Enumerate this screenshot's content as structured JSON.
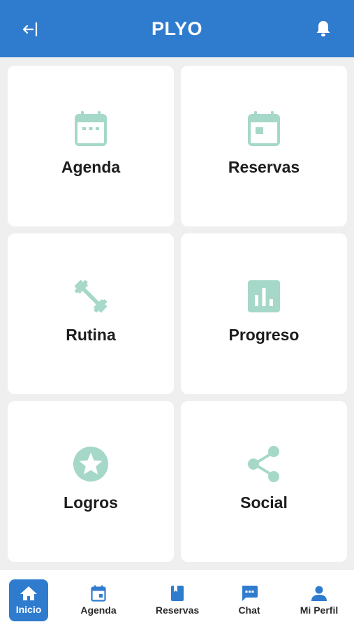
{
  "header": {
    "title": "PLYO",
    "back_icon": "logout-arrow-icon",
    "bell_icon": "bell-icon"
  },
  "colors": {
    "primary": "#2f7ccf",
    "icon_tint": "#a6d8c9",
    "background": "#efefef"
  },
  "tiles": [
    {
      "label": "Agenda",
      "icon": "calendar-icon"
    },
    {
      "label": "Reservas",
      "icon": "calendar-event-icon"
    },
    {
      "label": "Rutina",
      "icon": "dumbbell-icon"
    },
    {
      "label": "Progreso",
      "icon": "bar-chart-icon"
    },
    {
      "label": "Logros",
      "icon": "star-badge-icon"
    },
    {
      "label": "Social",
      "icon": "share-icon"
    }
  ],
  "nav": [
    {
      "label": "Inicio",
      "icon": "home-icon",
      "active": true
    },
    {
      "label": "Agenda",
      "icon": "calendar-icon",
      "active": false
    },
    {
      "label": "Reservas",
      "icon": "bookmark-icon",
      "active": false
    },
    {
      "label": "Chat",
      "icon": "chat-icon",
      "active": false
    },
    {
      "label": "Mi Perfil",
      "icon": "person-icon",
      "active": false
    }
  ]
}
